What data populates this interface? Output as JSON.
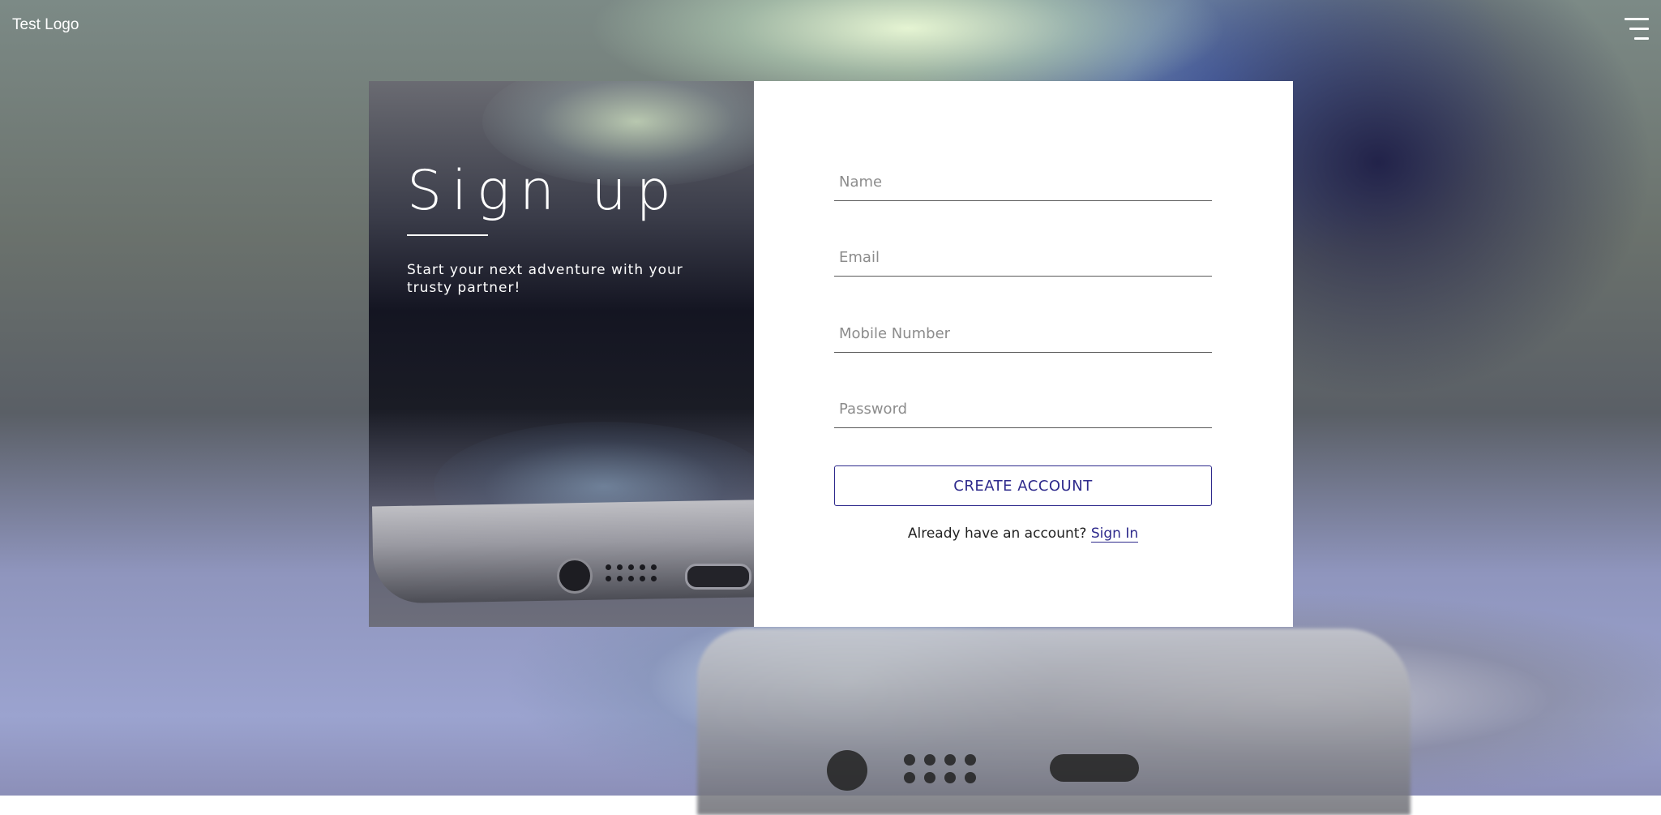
{
  "header": {
    "logo_text": "Test Logo",
    "menu_icon": "hamburger-menu-icon"
  },
  "hero": {
    "title": "Sign up",
    "subtitle": "Start your next adventure with your trusty partner!"
  },
  "form": {
    "name_placeholder": "Name",
    "name_value": "",
    "email_placeholder": "Email",
    "email_value": "",
    "mobile_placeholder": "Mobile Number",
    "mobile_value": "",
    "password_placeholder": "Password",
    "password_value": "",
    "submit_label": "CREATE ACCOUNT",
    "signin_prompt": "Already have an account?",
    "signin_link": "Sign In"
  },
  "colors": {
    "accent": "#2e2a8c",
    "panel_background": "#ffffff",
    "text_light": "#ffffff"
  }
}
